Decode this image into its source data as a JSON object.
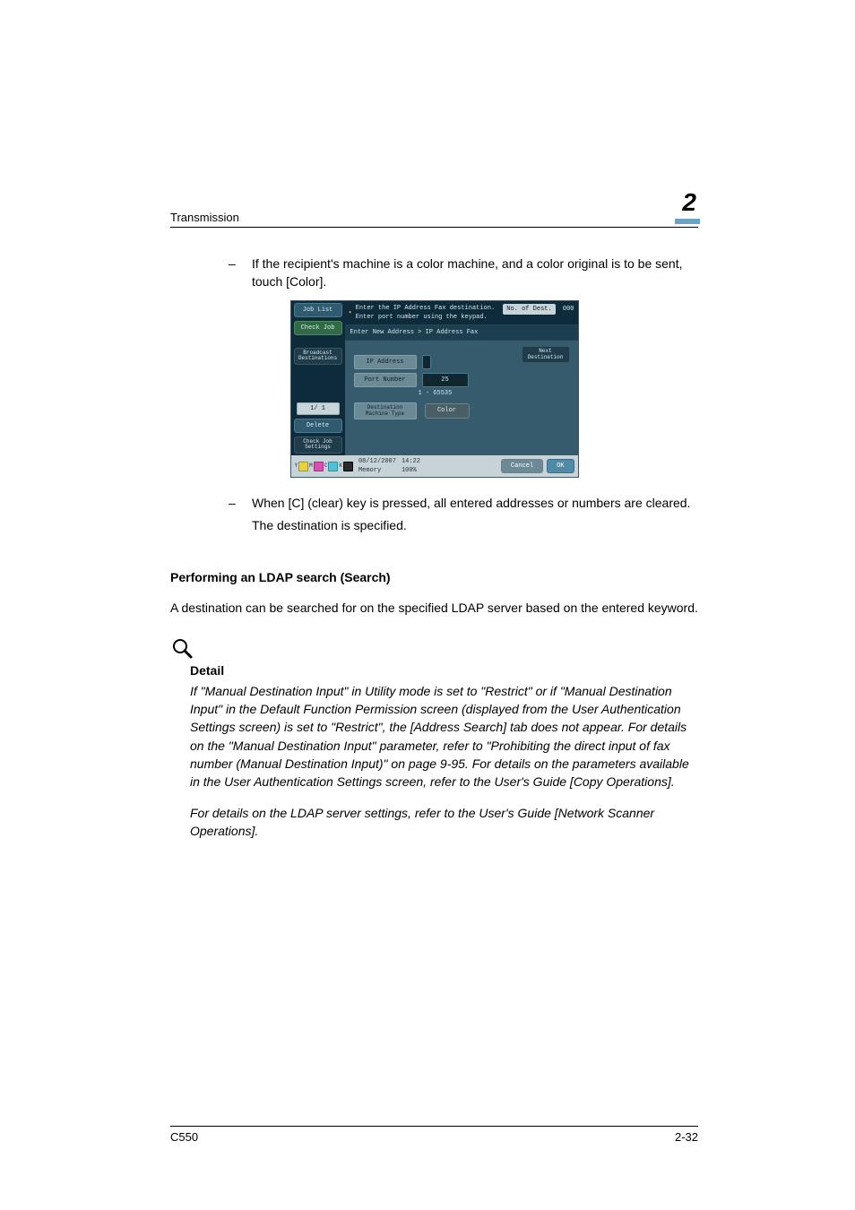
{
  "header": {
    "running_head": "Transmission",
    "chapter_number": "2"
  },
  "body": {
    "bullet1": "If the recipient's machine is a color machine, and a color original is to be sent, touch [Color].",
    "bullet2": "When [C] (clear) key is pressed, all entered addresses or numbers are cleared.",
    "result_line": "The destination is specified.",
    "subheading": "Performing an LDAP search (Search)",
    "ldap_intro": "A destination can be searched for on the specified LDAP server based on the entered keyword.",
    "detail_label": "Detail",
    "detail_para1": "If \"Manual Destination Input\" in Utility mode is set to \"Restrict\" or if \"Manual Destination Input\" in the Default Function Permission screen (displayed from the User Authentication Settings screen) is set to \"Restrict\", the [Address Search] tab does not appear. For details on the \"Manual Destination Input\" parameter, refer to \"Prohibiting the direct input of fax number (Manual Destination Input)\" on page 9-95. For details on the parameters available in the User Authentication Settings screen, refer to the User's Guide [Copy Operations].",
    "detail_para2": "For details on the LDAP server settings, refer to the User's Guide [Network Scanner Operations]."
  },
  "screenshot": {
    "hint_line1": "Enter the IP Address Fax destination.",
    "hint_line2": "Enter port number using the keypad.",
    "counter_label": "No. of Dest.",
    "counter_value": "000",
    "job_list": "Job List",
    "check_job": "Check Job",
    "broadcast": "Broadcast Destinations",
    "pager": "1/  1",
    "delete": "Delete",
    "check_job_settings": "Check Job Settings",
    "breadcrumb": "Enter New Address > IP Address Fax",
    "next_dest": "Next Destination",
    "ip_address_label": "IP Address",
    "port_number_label": "Port Number",
    "port_number_value": "25",
    "port_range": "1  -  65535",
    "machine_type_label": "Destination Machine Type",
    "color_btn": "Color",
    "footer_date": "08/12/2007",
    "footer_time": "14:22",
    "footer_mem_label": "Memory",
    "footer_mem_value": "100%",
    "cancel": "Cancel",
    "ok": "OK"
  },
  "footer": {
    "model": "C550",
    "page": "2-32"
  }
}
